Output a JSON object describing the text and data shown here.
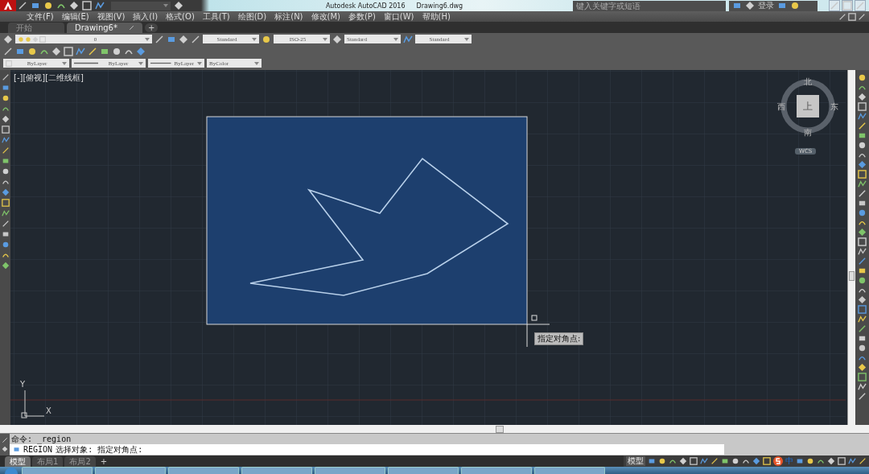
{
  "title_bar": {
    "app_title": "Autodesk AutoCAD 2016",
    "file_name": "Drawing6.dwg",
    "search_placeholder": "键入关键字或短语",
    "sign_in": "登录"
  },
  "menu_bar": [
    "文件(F)",
    "编辑(E)",
    "视图(V)",
    "插入(I)",
    "格式(O)",
    "工具(T)",
    "绘图(D)",
    "标注(N)",
    "修改(M)",
    "参数(P)",
    "窗口(W)",
    "帮助(H)"
  ],
  "file_tabs": [
    {
      "label": "开始",
      "selected": false
    },
    {
      "label": "Drawing6*",
      "selected": true
    }
  ],
  "new_tab": "+",
  "styles_toolbar": {
    "layer": "0",
    "text_style": "Standard",
    "dim_style": "ISO-25",
    "table_style": "Standard",
    "multileader_style": "Standard"
  },
  "properties_toolbar": {
    "color_setting": "ByLayer",
    "linetype": "ByLayer",
    "lineweight": "ByLayer",
    "plot_style": "ByColor"
  },
  "viewport_label": "[-][俯视][二维线框]",
  "view_cube": {
    "north": "北",
    "south": "南",
    "east": "东",
    "west": "西",
    "face": "上",
    "coordinate_system": "WCS"
  },
  "cursor_tooltip": "指定对角点:",
  "ucs_icon": {
    "x_axis": "X",
    "y_axis": "Y"
  },
  "command_line": {
    "history": "命令: _region",
    "command": "REGION",
    "prompt": "选择对象: 指定对角点:"
  },
  "layout_tabs": [
    {
      "label": "模型",
      "selected": true
    },
    {
      "label": "布局1",
      "selected": false
    },
    {
      "label": "布局2",
      "selected": false
    }
  ],
  "new_layout_tab": "+",
  "status_bar": {
    "mode": "模型",
    "ime": "中"
  }
}
